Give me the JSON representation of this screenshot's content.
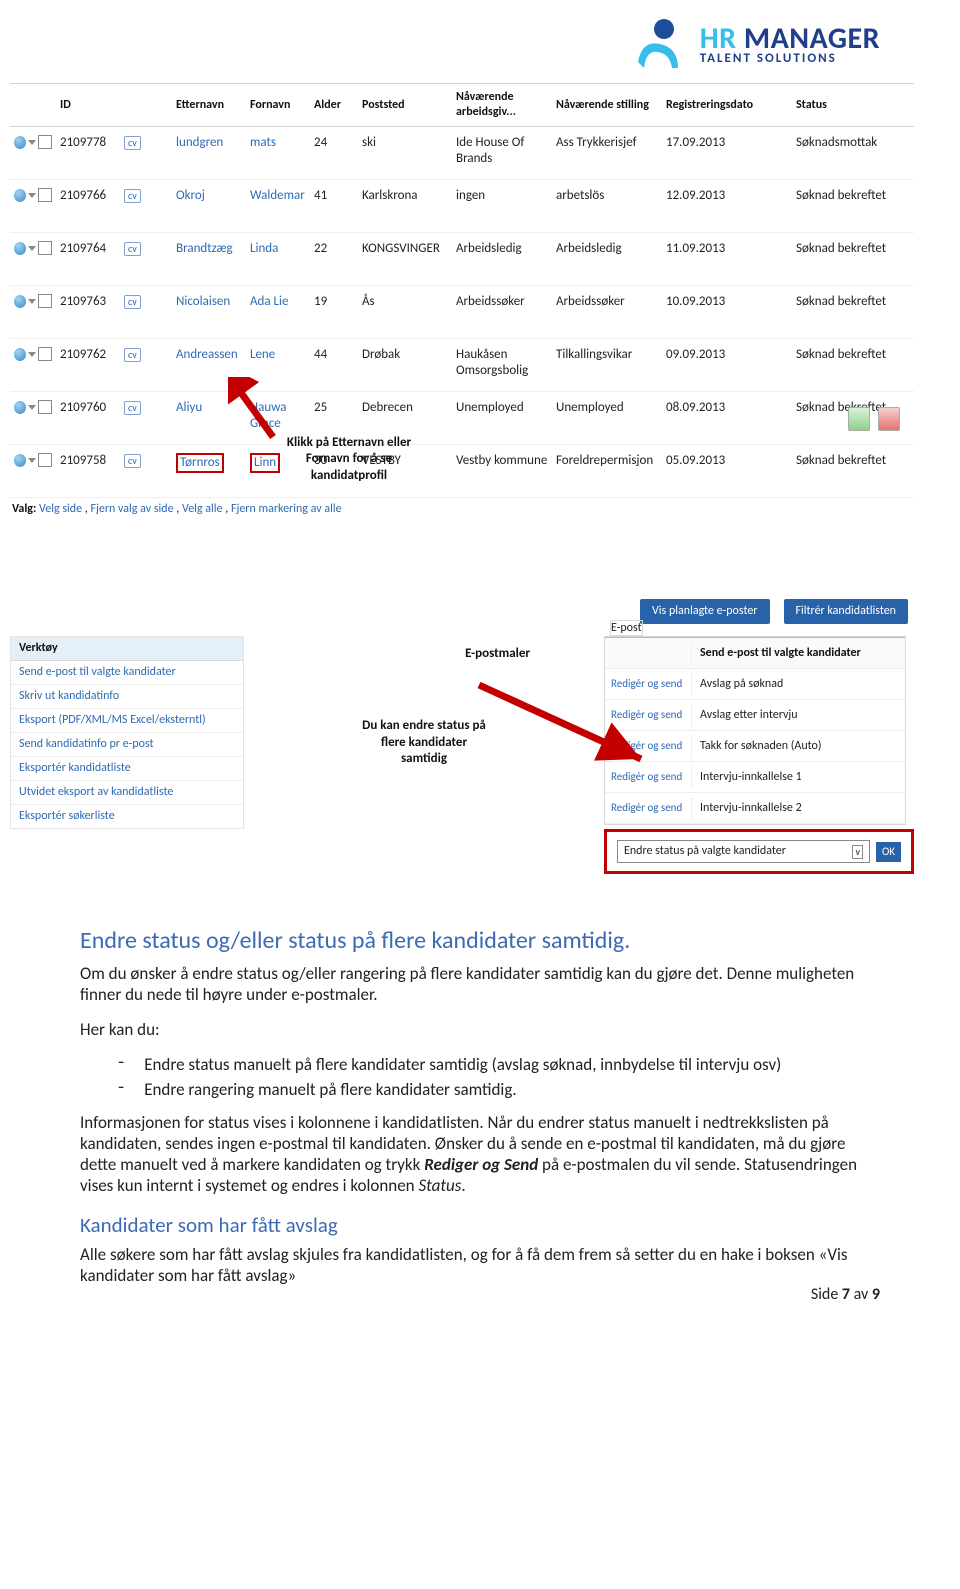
{
  "logo": {
    "brand_top": "HR",
    "brand_top2": "MANAGER",
    "brand_sub": "TALENT SOLUTIONS"
  },
  "table": {
    "headers": {
      "id": "ID",
      "etternavn": "Etternavn",
      "fornavn": "Fornavn",
      "alder": "Alder",
      "poststed": "Poststed",
      "navarb": "Nåværende arbeidsgiv...",
      "navstil": "Nåværende stilling",
      "regdato": "Registreringsdato",
      "status": "Status"
    },
    "rows": [
      {
        "id": "2109778",
        "cv": "cv",
        "ett": "lundgren",
        "for": "mats",
        "ald": "24",
        "post": "ski",
        "arb": "Ide House Of Brands",
        "stil": "Ass Trykkerisjef",
        "dato": "17.09.2013",
        "stat": "Søknadsmottak"
      },
      {
        "id": "2109766",
        "cv": "cv",
        "ett": "Okroj",
        "for": "Waldemar",
        "ald": "41",
        "post": "Karlskrona",
        "arb": "ingen",
        "stil": "arbetslös",
        "dato": "12.09.2013",
        "stat": "Søknad bekreftet"
      },
      {
        "id": "2109764",
        "cv": "cv",
        "ett": "Brandtzæg",
        "for": "Linda",
        "ald": "22",
        "post": "KONGSVINGER",
        "arb": "Arbeidsledig",
        "stil": "Arbeidsledig",
        "dato": "11.09.2013",
        "stat": "Søknad bekreftet"
      },
      {
        "id": "2109763",
        "cv": "cv",
        "ett": "Nicolaisen",
        "for": "Ada Lie",
        "ald": "19",
        "post": "Ås",
        "arb": "Arbeidssøker",
        "stil": "Arbeidssøker",
        "dato": "10.09.2013",
        "stat": "Søknad bekreftet"
      },
      {
        "id": "2109762",
        "cv": "cv",
        "ett": "Andreassen",
        "for": "Lene",
        "ald": "44",
        "post": "Drøbak",
        "arb": "Haukåsen Omsorgsbolig",
        "stil": "Tilkallingsvikar",
        "dato": "09.09.2013",
        "stat": "Søknad bekreftet"
      },
      {
        "id": "2109760",
        "cv": "cv",
        "ett": "Aliyu",
        "for": "Hauwa Grace",
        "ald": "25",
        "post": "Debrecen",
        "arb": "Unemployed",
        "stil": "Unemployed",
        "dato": "08.09.2013",
        "stat": "Søknad bekreftet"
      },
      {
        "id": "2109758",
        "cv": "cv",
        "ett": "Tørnros",
        "for": "Linn",
        "ald": "30",
        "post": "VESTBY",
        "arb": "Vestby kommune",
        "stil": "Foreldrepermisjon",
        "dato": "05.09.2013",
        "stat": "Søknad bekreftet"
      }
    ]
  },
  "valg": {
    "lbl": "Valg:",
    "a1": "Velg side",
    "a2": "Fjern valg av side",
    "a3": "Velg alle",
    "a4": "Fjern markering av alle"
  },
  "annot1_line1": "Klikk på Etternavn eller",
  "annot1_line2": "Fornavn for å se",
  "annot1_line3": "kandidatprofil",
  "btn1": "Vis planlagte e-poster",
  "btn2": "Filtrér kandidatlisten",
  "verktoy_hd": "Verktøy",
  "verktoy": [
    "Send e-post til valgte kandidater",
    "Skriv ut kandidatinfo",
    "Eksport (PDF/XML/MS Excel/eksterntl)",
    "Send kandidatinfo pr e-post",
    "Eksportér kandidatliste",
    "Utvidet eksport av kandidatliste",
    "Eksportér søkerliste"
  ],
  "epostmaler_title": "E-postmaler",
  "annot2_line1": "Du kan endre status på",
  "annot2_line2": "flere kandidater",
  "annot2_line3": "samtidig",
  "epost_tab": "E-post",
  "epost_hd_act": "",
  "epost_hd_lbl": "Send e-post til valgte kandidater",
  "epost_rows": [
    {
      "act": "Redigér og send",
      "lbl": "Avslag på søknad"
    },
    {
      "act": "Redigér og send",
      "lbl": "Avslag etter intervju"
    },
    {
      "act": "Redigér og send",
      "lbl": "Takk for søknaden (Auto)"
    },
    {
      "act": "Redigér og send",
      "lbl": "Intervju-innkallelse 1"
    },
    {
      "act": "Redigér og send",
      "lbl": "Intervju-innkallelse 2"
    }
  ],
  "status_dd": "Endre status på valgte kandidater",
  "ok": "OK",
  "doc": {
    "h1": "Endre status og/eller status på flere kandidater samtidig.",
    "p1": "Om du ønsker å endre status og/eller rangering på flere kandidater samtidig kan du gjøre det. Denne muligheten finner du nede til høyre under e-postmaler.",
    "p2": "Her kan du:",
    "b1": "Endre status manuelt på flere kandidater samtidig (avslag søknad, innbydelse til intervju osv)",
    "b2": "Endre rangering manuelt på flere kandidater samtidig.",
    "p3a": "Informasjonen for status vises i kolonnene i kandidatlisten. Når du endrer status manuelt i nedtrekkslisten på kandidaten, sendes ingen e-postmal til kandidaten. Ønsker du å sende en e-postmal til kandidaten, må du gjøre dette manuelt ved å markere kandidaten og trykk ",
    "p3b": "Rediger og Send",
    "p3c": " på e-postmalen du vil sende. Statusendringen vises kun internt i systemet og endres i kolonnen ",
    "p3d": "Status",
    "p3e": ".",
    "h2": "Kandidater som har fått avslag",
    "p4": "Alle søkere som har fått avslag skjules fra kandidatlisten, og for å få dem frem så setter du en hake i boksen «Vis kandidater som har fått avslag»"
  },
  "footer": {
    "pre": "Side ",
    "n": "7",
    "mid": " av ",
    "tot": "9"
  }
}
